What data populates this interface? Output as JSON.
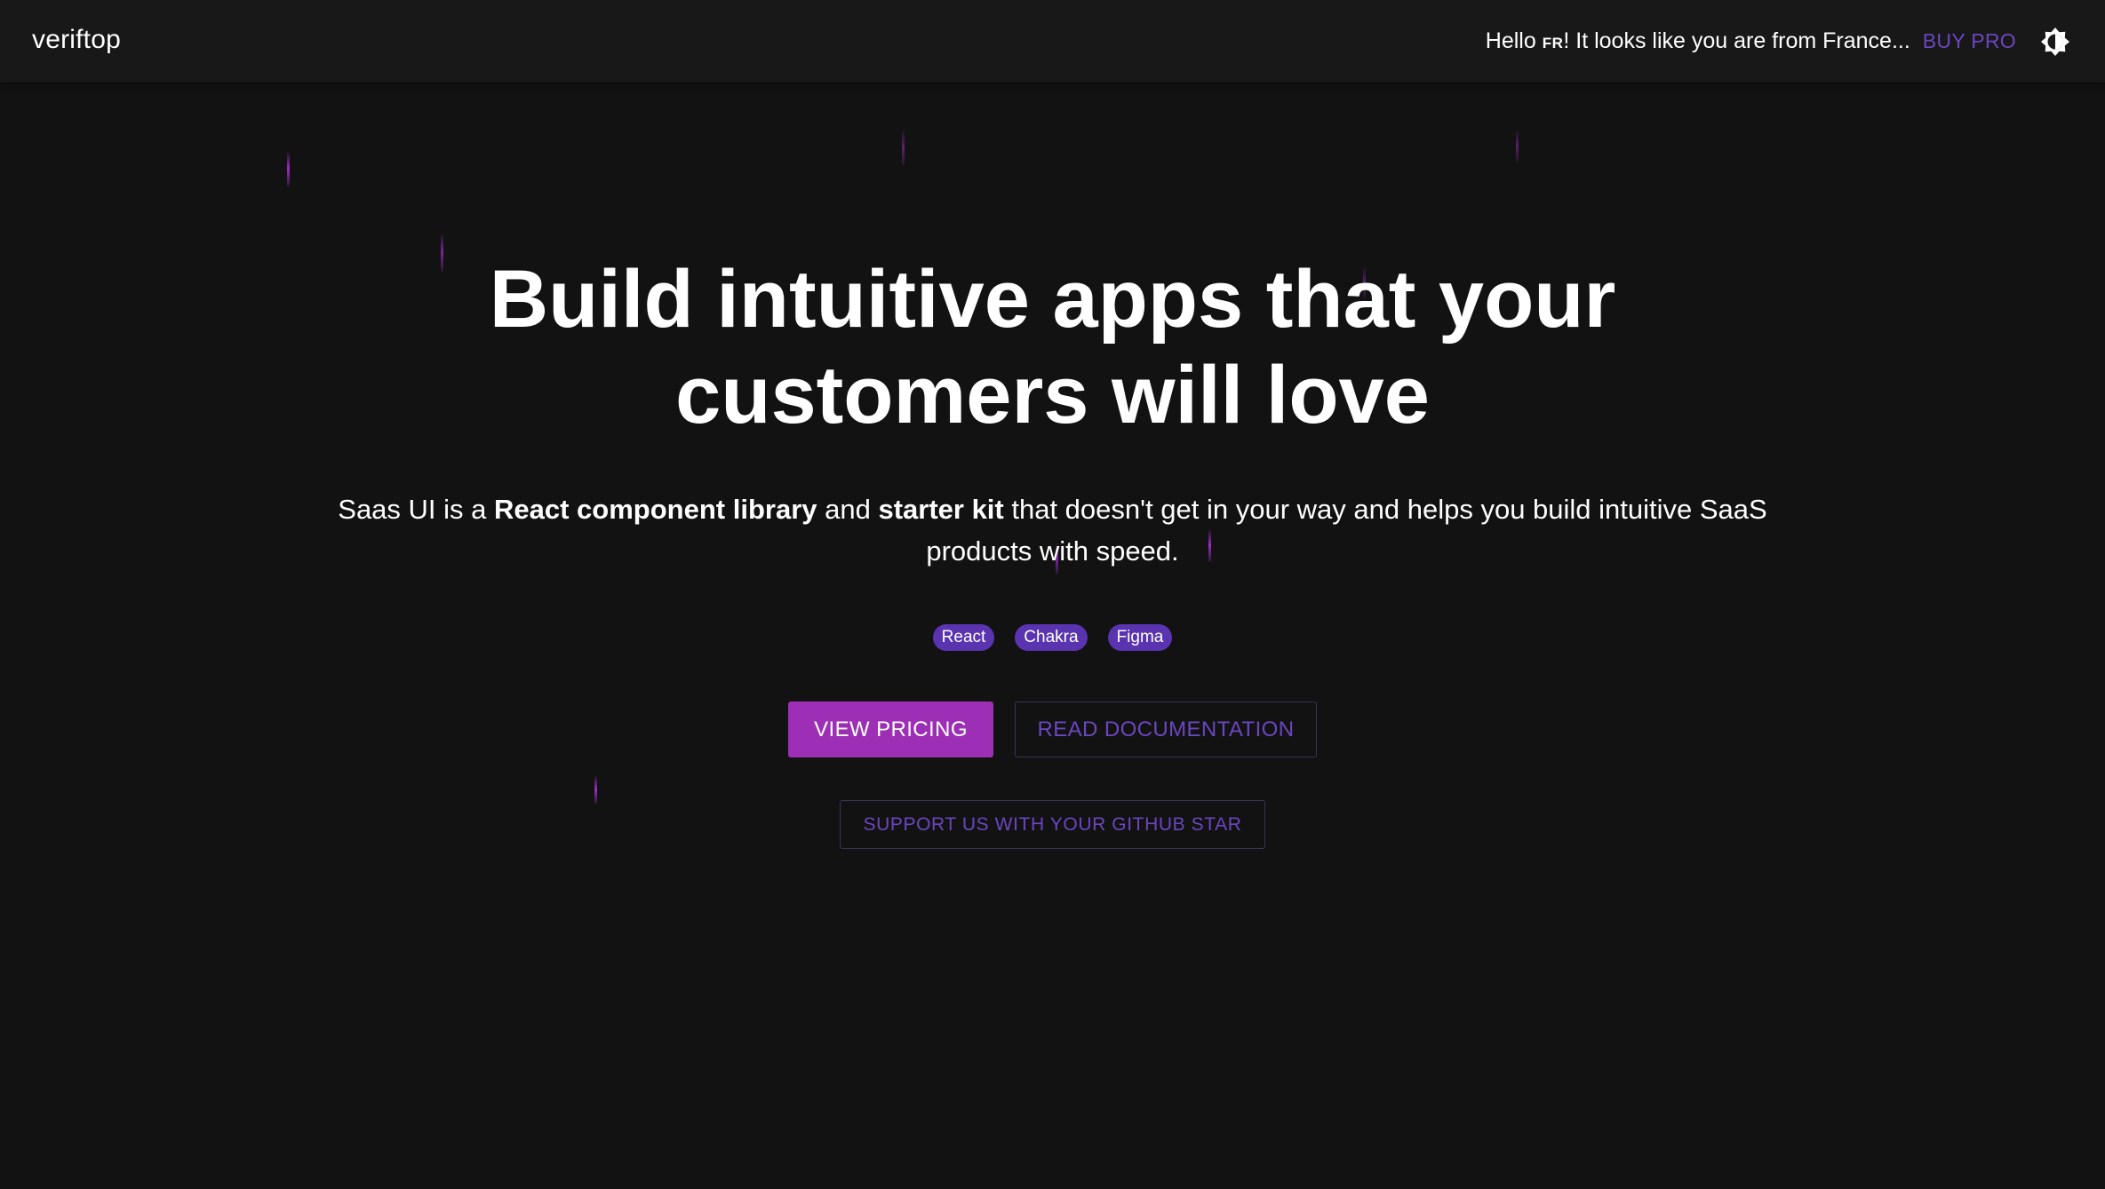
{
  "nav": {
    "logo": "veriftop",
    "greeting_prefix": "Hello ",
    "flag_code": "FR",
    "greeting_suffix": "! It looks like you are from France...",
    "buy_pro_label": "BUY PRO",
    "theme_toggle_icon": "theme-toggle-icon"
  },
  "hero": {
    "headline_line1": "Build intuitive apps that your",
    "headline_line2": "customers will love",
    "subtitle_part1": "Saas UI is a ",
    "subtitle_bold1": "React component library",
    "subtitle_part2": " and ",
    "subtitle_bold2": "starter kit",
    "subtitle_part3": " that doesn't get in your way and helps you build intuitive SaaS products with speed.",
    "tags": [
      "React",
      "Chakra",
      "Figma"
    ],
    "view_pricing_label": "VIEW PRICING",
    "read_docs_label": "READ DOCUMENTATION",
    "github_star_label": "SUPPORT US WITH YOUR GITHUB STAR"
  },
  "colors": {
    "background": "#121212",
    "navbar": "#181818",
    "accent_purple": "#6b46c1",
    "primary_button": "#9c2fb5",
    "tag_bg": "#5a34b0",
    "streak": "#9b2fc4"
  }
}
